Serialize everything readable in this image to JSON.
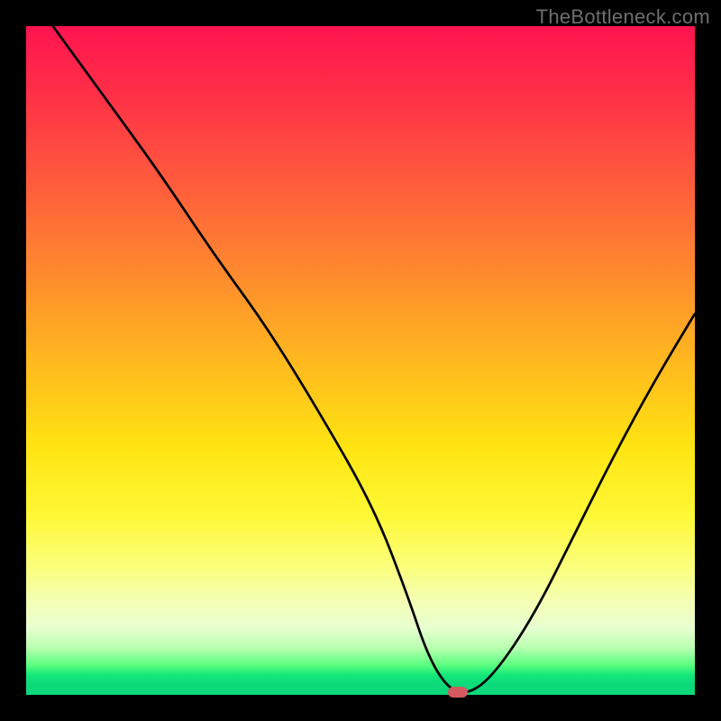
{
  "watermark": "TheBottleneck.com",
  "chart_data": {
    "type": "line",
    "title": "",
    "xlabel": "",
    "ylabel": "",
    "xlim": [
      0,
      100
    ],
    "ylim": [
      0,
      100
    ],
    "x": [
      4,
      12,
      20,
      28,
      36,
      44,
      52,
      57,
      60,
      63,
      66,
      70,
      76,
      82,
      88,
      94,
      100
    ],
    "values": [
      100,
      89,
      78,
      66,
      55,
      42,
      28,
      15,
      6,
      1,
      0,
      3,
      12,
      24,
      36,
      47,
      57
    ],
    "marker": {
      "x": 64.5,
      "y": 0
    },
    "gradient_bands": [
      {
        "color": "red-pink",
        "y_start": 100,
        "y_end": 70
      },
      {
        "color": "orange",
        "y_start": 70,
        "y_end": 40
      },
      {
        "color": "yellow",
        "y_start": 40,
        "y_end": 12
      },
      {
        "color": "pale",
        "y_start": 12,
        "y_end": 4
      },
      {
        "color": "green",
        "y_start": 4,
        "y_end": 0
      }
    ]
  }
}
